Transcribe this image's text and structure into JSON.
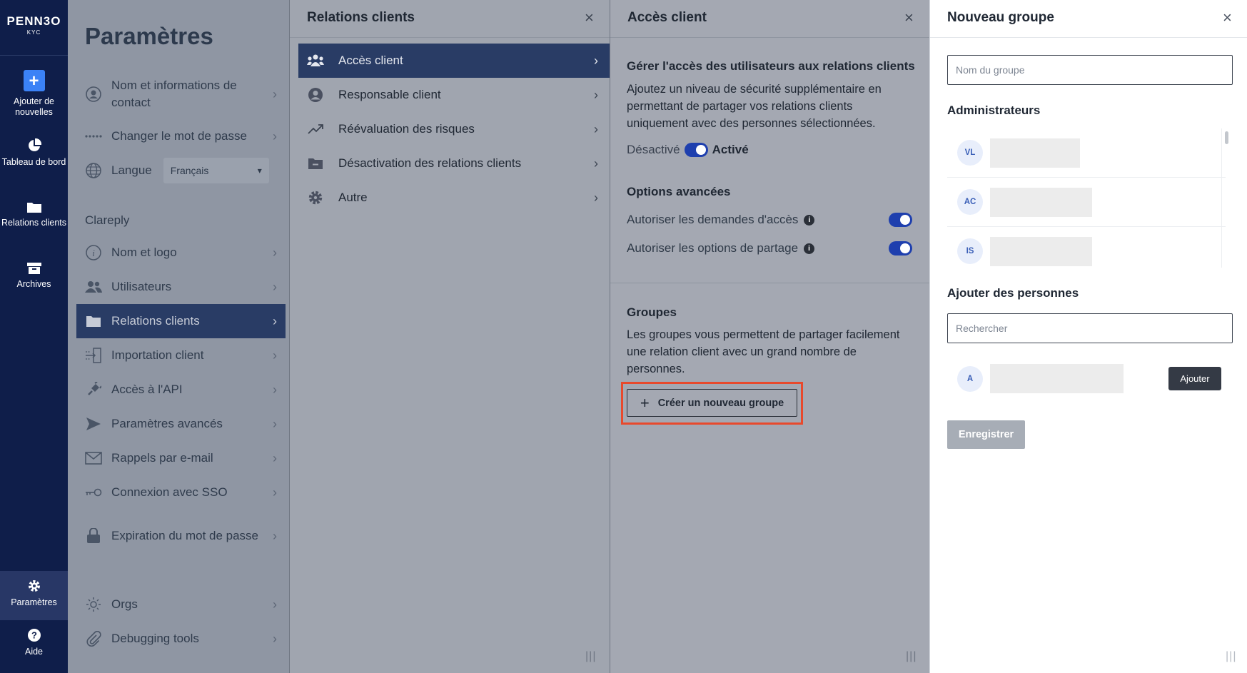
{
  "brand": {
    "name": "PENN3O",
    "sub": "KYC"
  },
  "nav": {
    "add_label": "Ajouter de nouvelles",
    "dashboard_label": "Tableau de bord",
    "clients_label": "Relations clients",
    "archives_label": "Archives",
    "settings_label": "Paramètres",
    "help_label": "Aide"
  },
  "settings": {
    "title": "Paramètres",
    "items_top": [
      {
        "label": "Nom et informations de contact",
        "icon": "user-circle-icon"
      },
      {
        "label": "Changer le mot de passe",
        "icon": "password-dots-icon"
      }
    ],
    "language": {
      "label": "Langue",
      "value": "Français",
      "icon": "globe-icon"
    },
    "section_heading": "Clareply",
    "items": [
      {
        "label": "Nom et logo",
        "icon": "info-icon"
      },
      {
        "label": "Utilisateurs",
        "icon": "users-icon"
      },
      {
        "label": "Relations clients",
        "icon": "folder-icon",
        "active": true
      },
      {
        "label": "Importation client",
        "icon": "import-icon"
      },
      {
        "label": "Accès à l'API",
        "icon": "plug-icon"
      },
      {
        "label": "Paramètres avancés",
        "icon": "send-icon"
      },
      {
        "label": "Rappels par e-mail",
        "icon": "mail-icon"
      },
      {
        "label": "Connexion avec SSO",
        "icon": "key-icon"
      },
      {
        "label": "Expiration du mot de passe",
        "icon": "lock-icon"
      },
      {
        "label": "Orgs",
        "icon": "sun-icon"
      },
      {
        "label": "Debugging tools",
        "icon": "clip-icon"
      }
    ]
  },
  "panel1": {
    "title": "Relations clients",
    "items": [
      {
        "label": "Accès client",
        "icon": "people-icon",
        "active": true
      },
      {
        "label": "Responsable client",
        "icon": "user-circle-icon"
      },
      {
        "label": "Réévaluation des risques",
        "icon": "trend-icon"
      },
      {
        "label": "Désactivation des relations clients",
        "icon": "folder-minus-icon"
      },
      {
        "label": "Autre",
        "icon": "gear-icon"
      }
    ]
  },
  "panel2": {
    "title": "Accès client",
    "manage_heading": "Gérer l'accès des utilisateurs aux relations clients",
    "manage_text": "Ajoutez un niveau de sécurité supplémentaire en permettant de partager vos relations clients uniquement avec des personnes sélectionnées.",
    "toggle_off_label": "Désactivé",
    "toggle_on_label": "Activé",
    "toggle_state": "on",
    "advanced_heading": "Options avancées",
    "option1": "Autoriser les demandes d'accès",
    "option2": "Autoriser les options de partage",
    "groups_heading": "Groupes",
    "groups_text": "Les groupes vous permettent de partager facilement une relation client avec un grand nombre de personnes.",
    "create_button": "Créer un nouveau groupe"
  },
  "panel3": {
    "title": "Nouveau groupe",
    "group_name_placeholder": "Nom du groupe",
    "admins_heading": "Administrateurs",
    "admins": [
      {
        "initials": "VL"
      },
      {
        "initials": "AC"
      },
      {
        "initials": "IS"
      }
    ],
    "add_people_heading": "Ajouter des personnes",
    "search_placeholder": "Rechercher",
    "candidate_initials": "A",
    "add_button": "Ajouter",
    "save_button": "Enregistrer"
  }
}
